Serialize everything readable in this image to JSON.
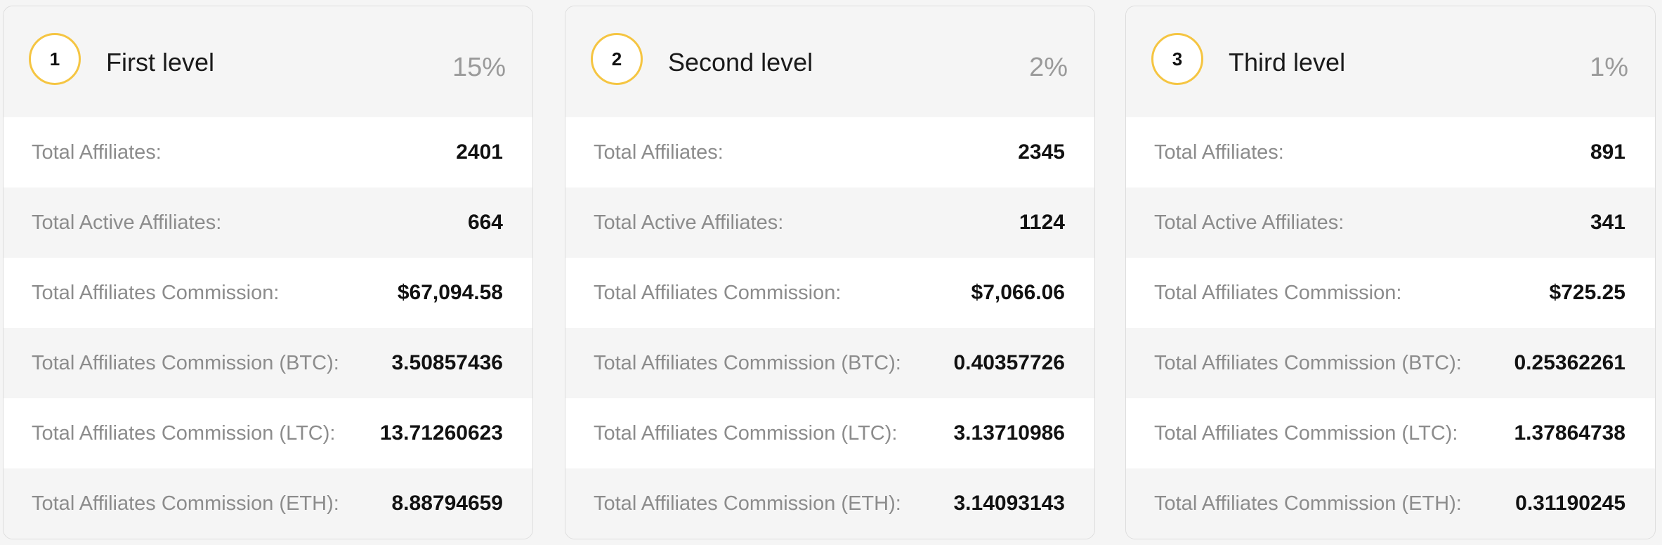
{
  "levels": [
    {
      "number": "1",
      "title": "First level",
      "percent": "15%",
      "stats": [
        {
          "label": "Total Affiliates:",
          "value": "2401"
        },
        {
          "label": "Total Active Affiliates:",
          "value": "664"
        },
        {
          "label": "Total Affiliates Commission:",
          "value": "$67,094.58"
        },
        {
          "label": "Total Affiliates Commission (BTC):",
          "value": "3.50857436"
        },
        {
          "label": "Total Affiliates Commission (LTC):",
          "value": "13.71260623"
        },
        {
          "label": "Total Affiliates Commission (ETH):",
          "value": "8.88794659"
        }
      ]
    },
    {
      "number": "2",
      "title": "Second level",
      "percent": "2%",
      "stats": [
        {
          "label": "Total Affiliates:",
          "value": "2345"
        },
        {
          "label": "Total Active Affiliates:",
          "value": "1124"
        },
        {
          "label": "Total Affiliates Commission:",
          "value": "$7,066.06"
        },
        {
          "label": "Total Affiliates Commission (BTC):",
          "value": "0.40357726"
        },
        {
          "label": "Total Affiliates Commission (LTC):",
          "value": "3.13710986"
        },
        {
          "label": "Total Affiliates Commission (ETH):",
          "value": "3.14093143"
        }
      ]
    },
    {
      "number": "3",
      "title": "Third level",
      "percent": "1%",
      "stats": [
        {
          "label": "Total Affiliates:",
          "value": "891"
        },
        {
          "label": "Total Active Affiliates:",
          "value": "341"
        },
        {
          "label": "Total Affiliates Commission:",
          "value": "$725.25"
        },
        {
          "label": "Total Affiliates Commission (BTC):",
          "value": "0.25362261"
        },
        {
          "label": "Total Affiliates Commission (LTC):",
          "value": "1.37864738"
        },
        {
          "label": "Total Affiliates Commission (ETH):",
          "value": "0.31190245"
        }
      ]
    }
  ],
  "colors": {
    "accent": "#f5c542",
    "card_background": "#f7f7f7",
    "row_alt": "#ffffff"
  }
}
